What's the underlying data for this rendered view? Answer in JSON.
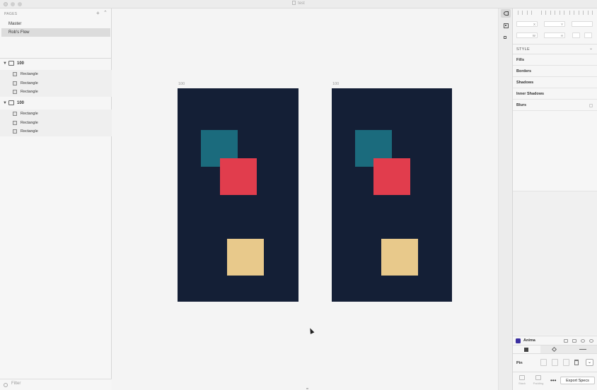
{
  "window": {
    "title": "test"
  },
  "left_panel": {
    "pages_header": "PAGES",
    "pages": [
      {
        "label": "Master",
        "selected": false
      },
      {
        "label": "Rob's Flow",
        "selected": true
      }
    ],
    "layer_groups": [
      {
        "label": "100",
        "layers": [
          "Rectangle",
          "Rectangle",
          "Rectangle"
        ]
      },
      {
        "label": "100",
        "layers": [
          "Rectangle",
          "Rectangle",
          "Rectangle"
        ]
      }
    ],
    "filter_placeholder": "Filter"
  },
  "canvas": {
    "artboards": [
      {
        "label": "100"
      },
      {
        "label": "100"
      }
    ],
    "colors": {
      "artboard": "#141f36",
      "teal": "#1b6b7d",
      "red": "#e13d4d",
      "sand": "#e8c98b"
    }
  },
  "inspector": {
    "fields": {
      "x": "X",
      "y": "Y",
      "w": "W",
      "h": "H"
    },
    "style_header": "STYLE",
    "sections": [
      "Fills",
      "Borders",
      "Shadows",
      "Inner Shadows",
      "Blurs"
    ]
  },
  "anima": {
    "title": "Anima",
    "pin_label": "Pin",
    "bottom_tools": [
      "Stack",
      "Padding"
    ],
    "export_label": "Export Specs"
  }
}
